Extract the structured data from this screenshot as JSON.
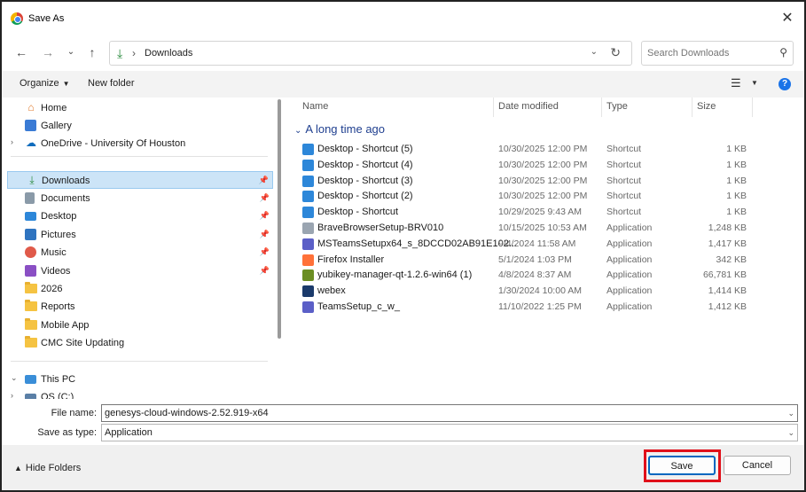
{
  "window": {
    "title": "Save As",
    "close": "✕"
  },
  "nav": {
    "back": "←",
    "forward": "→",
    "recent": "⌄",
    "up": "↑",
    "path": "Downloads",
    "search_placeholder": "Search Downloads"
  },
  "commands": {
    "organize": "Organize",
    "new_folder": "New folder"
  },
  "sidebar": {
    "items": [
      {
        "label": "Home",
        "icon": "home-icon"
      },
      {
        "label": "Gallery",
        "icon": "gallery-icon"
      },
      {
        "label": "OneDrive - University Of Houston",
        "icon": "onedrive-icon"
      },
      {
        "label": "Downloads",
        "icon": "download-icon",
        "selected": true
      },
      {
        "label": "Documents",
        "icon": "documents-icon"
      },
      {
        "label": "Desktop",
        "icon": "desktop-icon"
      },
      {
        "label": "Pictures",
        "icon": "pictures-icon"
      },
      {
        "label": "Music",
        "icon": "music-icon"
      },
      {
        "label": "Videos",
        "icon": "videos-icon"
      },
      {
        "label": "2026",
        "icon": "folder-icon"
      },
      {
        "label": "Reports",
        "icon": "folder-icon"
      },
      {
        "label": "Mobile App",
        "icon": "folder-icon"
      },
      {
        "label": "CMC Site Updating",
        "icon": "folder-icon"
      },
      {
        "label": "This PC",
        "icon": "this-pc-icon"
      },
      {
        "label": "OS (C:)",
        "icon": "drive-icon"
      }
    ]
  },
  "columns": {
    "name": "Name",
    "date": "Date modified",
    "type": "Type",
    "size": "Size"
  },
  "group": "A long time ago",
  "files": [
    {
      "name": "Desktop - Shortcut (5)",
      "date": "10/30/2025 12:00 PM",
      "type": "Shortcut",
      "size": "1 KB",
      "icon": "shortcut-icon"
    },
    {
      "name": "Desktop - Shortcut (4)",
      "date": "10/30/2025 12:00 PM",
      "type": "Shortcut",
      "size": "1 KB",
      "icon": "shortcut-icon"
    },
    {
      "name": "Desktop - Shortcut (3)",
      "date": "10/30/2025 12:00 PM",
      "type": "Shortcut",
      "size": "1 KB",
      "icon": "shortcut-icon"
    },
    {
      "name": "Desktop - Shortcut (2)",
      "date": "10/30/2025 12:00 PM",
      "type": "Shortcut",
      "size": "1 KB",
      "icon": "shortcut-icon"
    },
    {
      "name": "Desktop - Shortcut",
      "date": "10/29/2025 9:43 AM",
      "type": "Shortcut",
      "size": "1 KB",
      "icon": "shortcut-icon"
    },
    {
      "name": "BraveBrowserSetup-BRV010",
      "date": "10/15/2025 10:53 AM",
      "type": "Application",
      "size": "1,248 KB",
      "icon": "installer-icon"
    },
    {
      "name": "MSTeamsSetupx64_s_8DCCD02AB91E102...",
      "date": "9/4/2024 11:58 AM",
      "type": "Application",
      "size": "1,417 KB",
      "icon": "teams-icon"
    },
    {
      "name": "Firefox Installer",
      "date": "5/1/2024 1:03 PM",
      "type": "Application",
      "size": "342 KB",
      "icon": "firefox-icon"
    },
    {
      "name": "yubikey-manager-qt-1.2.6-win64 (1)",
      "date": "4/8/2024 8:37 AM",
      "type": "Application",
      "size": "66,781 KB",
      "icon": "yubikey-icon"
    },
    {
      "name": "webex",
      "date": "1/30/2024 10:00 AM",
      "type": "Application",
      "size": "1,414 KB",
      "icon": "webex-icon"
    },
    {
      "name": "TeamsSetup_c_w_",
      "date": "11/10/2022 1:25 PM",
      "type": "Application",
      "size": "1,412 KB",
      "icon": "teams-icon"
    }
  ],
  "fields": {
    "file_name_label": "File name:",
    "file_name_value": "genesys-cloud-windows-2.52.919-x64",
    "save_type_label": "Save as type:",
    "save_type_value": "Application"
  },
  "footer": {
    "hide_folders": "Hide Folders",
    "save": "Save",
    "cancel": "Cancel"
  },
  "colors": {
    "accent": "#0067c0",
    "selection": "#cce4f7",
    "highlight": "#e0101a"
  }
}
